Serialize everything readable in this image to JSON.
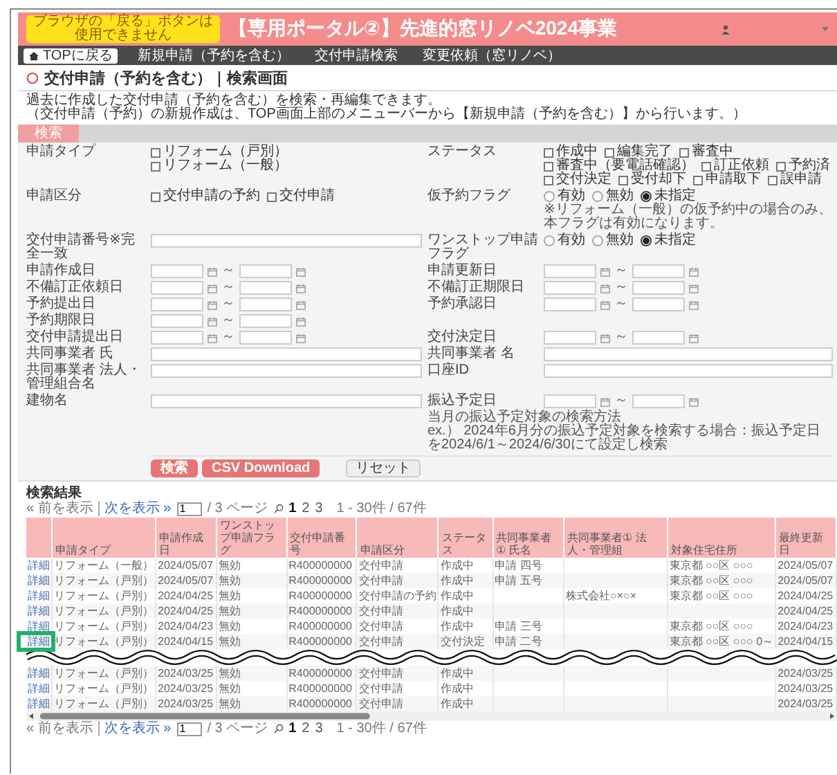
{
  "header": {
    "notice_badge": [
      "ブラウザの「戻る」ボタンは",
      "使用できません"
    ],
    "title": "【専用ポータル②】先進的窓リノベ2024事業"
  },
  "nav": [
    {
      "label": "TOPに戻る",
      "kind": "home"
    },
    {
      "label": "新規申請（予約を含む）",
      "kind": "link"
    },
    {
      "label": "交付申請検索",
      "kind": "link"
    },
    {
      "label": "変更依頼（窓リノベ）",
      "kind": "link"
    }
  ],
  "page_title": "交付申請（予約を含む）｜検索画面",
  "description": [
    "過去に作成した交付申請（予約を含む）を検索・再編集できます。",
    "（交付申請（予約）の新規作成は、TOP画面上部のメニューバーから【新規申請（予約を含む）】から行います。）"
  ],
  "search_tab": "検索",
  "form": {
    "rows": [
      {
        "left": {
          "label": "申請タイプ",
          "kind": "checkboxes",
          "options": [
            {
              "label": "リフォーム（戸別）",
              "checked": false
            },
            {
              "label": "リフォーム（一般）",
              "checked": false
            }
          ]
        },
        "right": {
          "label": "ステータス",
          "kind": "checkboxes",
          "options": [
            {
              "label": "作成中",
              "checked": false
            },
            {
              "label": "編集完了",
              "checked": false
            },
            {
              "label": "審査中",
              "checked": false
            },
            {
              "label": "審査中（要電話確認）",
              "checked": false
            },
            {
              "label": "訂正依頼",
              "checked": false
            },
            {
              "label": "予約済",
              "checked": false
            },
            {
              "label": "交付決定",
              "checked": false
            },
            {
              "label": "受付却下",
              "checked": false
            },
            {
              "label": "申請取下",
              "checked": false
            },
            {
              "label": "誤申請",
              "checked": false
            }
          ]
        }
      },
      {
        "left": {
          "label": "申請区分",
          "kind": "checkboxes",
          "options": [
            {
              "label": "交付申請の予約",
              "checked": false
            },
            {
              "label": "交付申請",
              "checked": false
            }
          ]
        },
        "right": {
          "label": "仮予約フラグ",
          "kind": "radios",
          "options": [
            {
              "label": "有効",
              "selected": false
            },
            {
              "label": "無効",
              "selected": false
            },
            {
              "label": "未指定",
              "selected": true
            }
          ],
          "note": "※リフォーム（一般）の仮予約中の場合のみ、本フラグは有効になります。"
        }
      },
      {
        "left": {
          "label": "交付申請番号",
          "label_note": "※完全一致",
          "kind": "text"
        },
        "right": {
          "label": "ワンストップ申請フラグ",
          "kind": "radios",
          "options": [
            {
              "label": "有効",
              "selected": false
            },
            {
              "label": "無効",
              "selected": false
            },
            {
              "label": "未指定",
              "selected": true
            }
          ]
        }
      },
      {
        "left": {
          "label": "申請作成日",
          "kind": "daterange",
          "separator": "～"
        },
        "right": {
          "label": "申請更新日",
          "kind": "daterange",
          "separator": "～"
        }
      },
      {
        "left": {
          "label": "不備訂正依頼日",
          "kind": "daterange",
          "separator": "～"
        },
        "right": {
          "label": "不備訂正期限日",
          "kind": "daterange",
          "separator": "～"
        }
      },
      {
        "left": {
          "label": "予約提出日",
          "kind": "daterange",
          "separator": "～"
        },
        "right": {
          "label": "予約承認日",
          "kind": "daterange",
          "separator": "～"
        }
      },
      {
        "left": {
          "label": "予約期限日",
          "kind": "daterange",
          "separator": "～"
        }
      },
      {
        "left": {
          "label": "交付申請提出日",
          "kind": "daterange",
          "separator": "～"
        },
        "right": {
          "label": "交付決定日",
          "kind": "daterange",
          "separator": "～"
        }
      },
      {
        "left": {
          "label": "共同事業者 氏",
          "kind": "text"
        },
        "right": {
          "label": "共同事業者 名",
          "kind": "text"
        }
      },
      {
        "left": {
          "label": "共同事業者 法人・管理組合名",
          "kind": "text"
        },
        "right": {
          "label": "口座ID",
          "kind": "text"
        }
      },
      {
        "left": {
          "label": "建物名",
          "kind": "text"
        },
        "right": {
          "label": "振込予定日",
          "kind": "daterange",
          "separator": "～",
          "note_lines": [
            "当月の振込予定対象の検索方法",
            "ex.） 2024年6月分の振込予定対象を検索する場合：振込予定日を2024/6/1～2024/6/30にて設定し検索"
          ]
        }
      }
    ],
    "buttons": [
      {
        "label": "検索",
        "kind": "primary"
      },
      {
        "label": "CSV Download",
        "kind": "primary"
      },
      {
        "label": "リセット",
        "kind": "secondary"
      }
    ]
  },
  "results": {
    "title": "検索結果",
    "pager_top": {
      "prev": "« 前を表示",
      "next": "次を表示 »",
      "page_input": "1",
      "page_total": "/ 3 ページ",
      "pages": [
        {
          "label": "1",
          "selected": true
        },
        {
          "label": "2",
          "selected": false
        },
        {
          "label": "3",
          "selected": false
        }
      ],
      "range": "1 - 30件 / 67件"
    },
    "columns": [
      "申請タイプ",
      "申請作成日",
      "ワンストップ申請フラグ",
      "交付申請番号",
      "申請区分",
      "ステータス",
      "共同事業者① 氏名",
      "共同事業者① 法人・管理組",
      "対象住宅住所",
      "最終更新日"
    ],
    "rows_before_break": [
      {
        "link": "詳細",
        "highlighted": false,
        "cells": [
          "リフォーム（一般）",
          "2024/05/07",
          "無効",
          "R400000000",
          "交付申請",
          "作成中",
          "申請 四号",
          "",
          "東京都 ○○区 ○○○",
          "2024/05/07"
        ]
      },
      {
        "link": "詳細",
        "highlighted": false,
        "cells": [
          "リフォーム（戸別）",
          "2024/05/07",
          "無効",
          "R400000000",
          "交付申請",
          "作成中",
          "申請 五号",
          "",
          "東京都 ○○区 ○○○",
          "2024/05/07"
        ]
      },
      {
        "link": "詳細",
        "highlighted": false,
        "cells": [
          "リフォーム（戸別）",
          "2024/04/25",
          "無効",
          "R400000000",
          "交付申請の予約",
          "作成中",
          "",
          "株式会社○×○×",
          "東京都 ○○区 ○○○",
          "2024/04/25"
        ]
      },
      {
        "link": "詳細",
        "highlighted": false,
        "cells": [
          "リフォーム（戸別）",
          "2024/04/25",
          "無効",
          "R400000000",
          "交付申請",
          "作成中",
          "",
          "",
          "",
          "2024/04/25"
        ]
      },
      {
        "link": "詳細",
        "highlighted": false,
        "cells": [
          "リフォーム（戸別）",
          "2024/04/23",
          "無効",
          "R400000000",
          "交付申請",
          "作成中",
          "申請 三号",
          "",
          "東京都 ○○区 ○○○",
          "2024/04/23"
        ]
      },
      {
        "link": "詳細",
        "highlighted": true,
        "cells": [
          "リフォーム（戸別）",
          "2024/04/15",
          "無効",
          "R400000000",
          "交付申請",
          "交付決定",
          "申請 二号",
          "",
          "東京都 ○○区 ○○○ 0～",
          "2024/04/15"
        ]
      }
    ],
    "rows_after_break": [
      {
        "link": "詳細",
        "highlighted": false,
        "cells": [
          "リフォーム（戸別）",
          "2024/03/25",
          "無効",
          "R400000000",
          "交付申請",
          "作成中",
          "",
          "",
          "",
          "2024/03/25"
        ]
      },
      {
        "link": "詳細",
        "highlighted": false,
        "cells": [
          "リフォーム（戸別）",
          "2024/03/25",
          "無効",
          "R400000000",
          "交付申請",
          "作成中",
          "",
          "",
          "",
          "2024/03/25"
        ]
      },
      {
        "link": "詳細",
        "highlighted": false,
        "cells": [
          "リフォーム（戸別）",
          "2024/03/25",
          "無効",
          "R400000000",
          "交付申請",
          "作成中",
          "",
          "",
          "",
          "2024/03/25"
        ]
      }
    ],
    "pager_bottom": {
      "prev": "« 前を表示",
      "next": "次を表示 »",
      "page_input": "1",
      "page_total": "/ 3 ページ",
      "pages": [
        {
          "label": "1",
          "selected": true
        },
        {
          "label": "2",
          "selected": false
        },
        {
          "label": "3",
          "selected": false
        }
      ],
      "range": "1 - 30件 / 67件"
    }
  }
}
